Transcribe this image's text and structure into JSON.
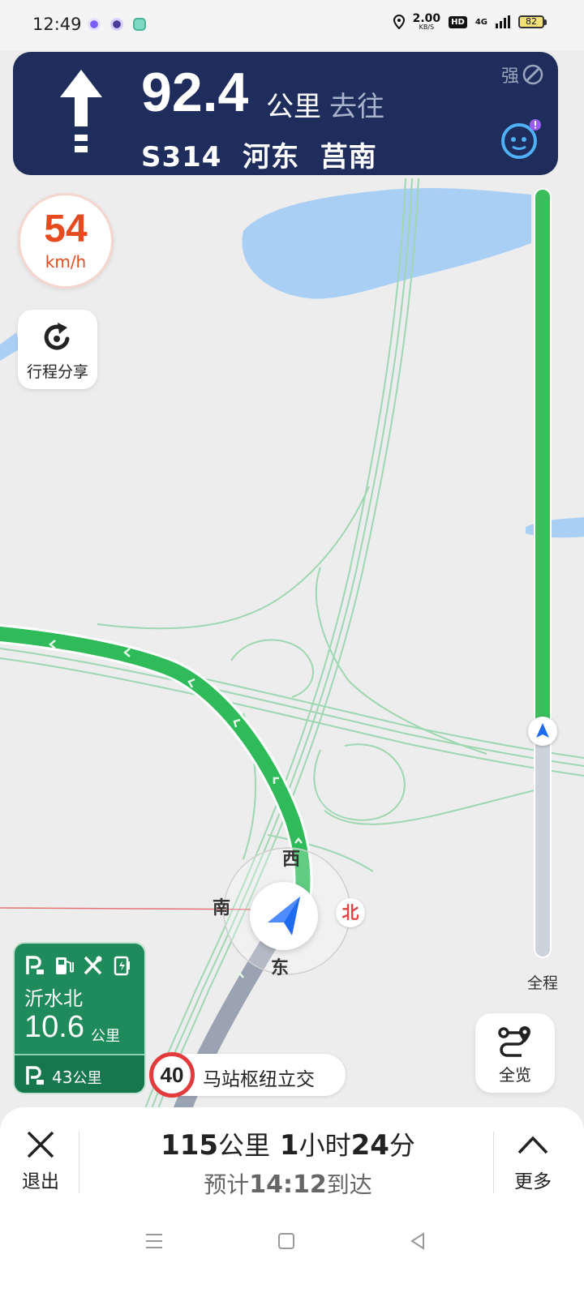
{
  "status": {
    "time": "12:49",
    "net_speed": "2.00",
    "net_unit": "KB/S",
    "hd": "HD",
    "signal": "4G",
    "battery": "82"
  },
  "banner": {
    "distance": "92.4",
    "distance_unit": "公里",
    "toward": "去往",
    "road": "S314  河东  莒南",
    "signal_label": "强",
    "maneuver_icon": "straight-arrow-icon"
  },
  "speed": {
    "value": "54",
    "unit": "km/h"
  },
  "share": {
    "label": "行程分享"
  },
  "progress": {
    "label": "全程",
    "fraction_remaining": 0.7
  },
  "map": {
    "compass": {
      "north": "北",
      "south": "南",
      "east": "东",
      "west": "西"
    }
  },
  "service_area": {
    "name": "沂水北",
    "distance": "10.6",
    "distance_unit": "公里",
    "next_distance": "43",
    "next_unit": "公里",
    "icons": [
      "parking-icon",
      "fuel-icon",
      "restaurant-icon",
      "charging-icon"
    ]
  },
  "speed_limit": {
    "value": "40",
    "road_name": "马站枢纽立交"
  },
  "overview": {
    "label": "全览"
  },
  "bottom": {
    "exit_label": "退出",
    "dist_value": "115",
    "dist_unit": "公里",
    "hours": "1",
    "hours_unit": "小时",
    "minutes": "24",
    "minutes_unit": "分",
    "eta_prefix": "预计",
    "eta_time": "14:12",
    "eta_suffix": "到达",
    "more_label": "更多"
  },
  "colors": {
    "banner": "#1f2d5c",
    "route": "#2fbb5a",
    "speed": "#e84a1f",
    "service_card": "#1f8a5a"
  }
}
